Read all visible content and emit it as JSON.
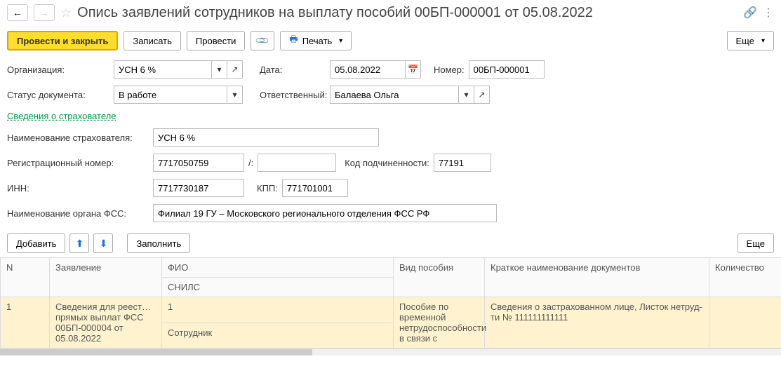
{
  "header": {
    "title": "Опись заявлений сотрудников на выплату пособий 00БП-000001 от 05.08.2022"
  },
  "toolbar": {
    "post_and_close": "Провести и закрыть",
    "save": "Записать",
    "post": "Провести",
    "print": "Печать",
    "more": "Еще"
  },
  "form": {
    "org_label": "Организация:",
    "org_value": "УСН 6 %",
    "date_label": "Дата:",
    "date_value": "05.08.2022",
    "number_label": "Номер:",
    "number_value": "00БП-000001",
    "status_label": "Статус документа:",
    "status_value": "В работе",
    "responsible_label": "Ответственный:",
    "responsible_value": "Балаева Ольга",
    "insurer_link": "Сведения о страхователе",
    "insurer_name_label": "Наименование страхователя:",
    "insurer_name_value": "УСН 6 %",
    "reg_number_label": "Регистрационный номер:",
    "reg_number_value": "7717050759",
    "slash": "/:",
    "sub_code_label": "Код подчиненности:",
    "sub_code_value": "77191",
    "inn_label": "ИНН:",
    "inn_value": "7717730187",
    "kpp_label": "КПП:",
    "kpp_value": "771701001",
    "fss_label": "Наименование органа ФСС:",
    "fss_value": "Филиал 19 ГУ – Московского регионального отделения ФСС РФ"
  },
  "table_toolbar": {
    "add": "Добавить",
    "fill": "Заполнить",
    "more": "Еще"
  },
  "table": {
    "headers": {
      "n": "N",
      "application": "Заявление",
      "fio": "ФИО",
      "snils": "СНИЛС",
      "benefit_type": "Вид пособия",
      "doc_short": "Краткое наименование документов",
      "qty": "Количество"
    },
    "rows": [
      {
        "n": "1",
        "application": "Сведения для реест… прямых выплат ФСС 00БП-000004 от 05.08.2022",
        "fio": "1",
        "snils": "Сотрудник",
        "benefit_type": "Пособие по временной нетрудоспособности в связи с",
        "doc_short": "Сведения о застрахованном лице, Листок нетруд-ти № 111111111111",
        "qty": ""
      }
    ]
  }
}
